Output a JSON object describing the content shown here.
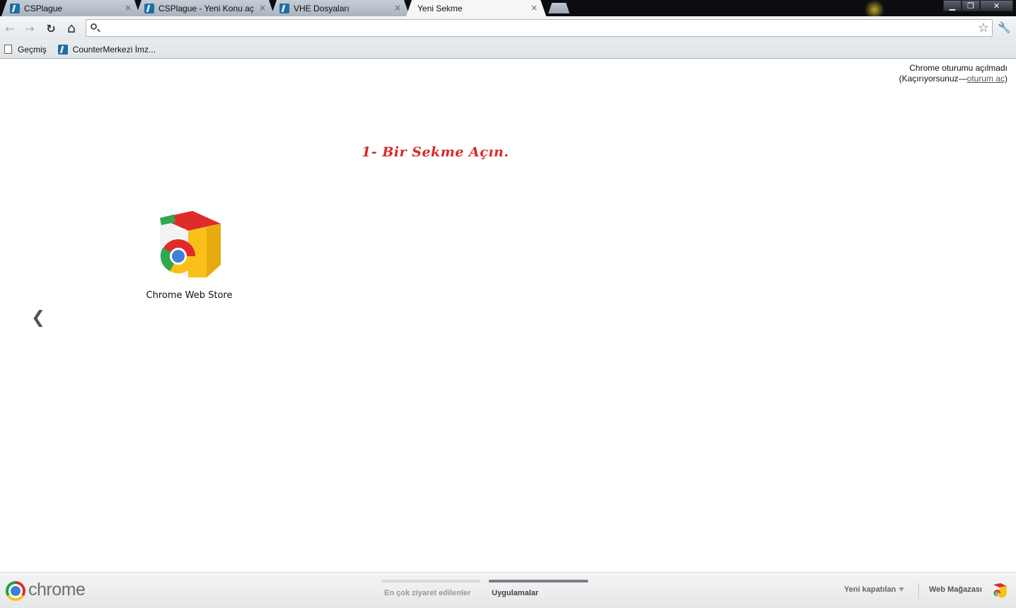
{
  "tabs": [
    {
      "title": "CSPlague",
      "active": false
    },
    {
      "title": "CSPlague - Yeni Konu aç",
      "active": false
    },
    {
      "title": "VHE Dosyaları",
      "active": false
    },
    {
      "title": "Yeni Sekme",
      "active": true
    }
  ],
  "tab_close_glyph": "×",
  "window_controls": {
    "minimize": "▁",
    "maximize": "❐",
    "close": "✕"
  },
  "toolbar": {
    "back_glyph": "←",
    "forward_glyph": "→",
    "reload_glyph": "↻",
    "home_glyph": "⌂",
    "omnibox_value": "",
    "star_glyph": "☆",
    "wrench_glyph": "🔧"
  },
  "bookmarks": [
    {
      "label": "Geçmiş",
      "icon": "page-icon"
    },
    {
      "label": "CounterMerkezi İmz...",
      "icon": "site-favicon"
    }
  ],
  "signin": {
    "line1": "Chrome oturumu açılmadı",
    "prefix": "(Kaçırıyorsunuz—",
    "link": "oturum aç",
    "suffix": ")"
  },
  "annotation": "1- Bir Sekme Açın.",
  "apps": [
    {
      "label": "Chrome Web Store",
      "icon": "chrome-web-store-icon"
    }
  ],
  "pager_left_glyph": "❮",
  "footer": {
    "brand": "chrome",
    "tabs": [
      {
        "label": "En çok ziyaret edilenler",
        "selected": false
      },
      {
        "label": "Uygulamalar",
        "selected": true
      }
    ],
    "recently_closed": "Yeni kapatılan",
    "web_store": "Web Mağazası"
  },
  "colors": {
    "annotation": "#d82a2a",
    "tab_active": "#f4f6f8",
    "tab_inactive": "#b8c0ca",
    "footer_selected_bar": "#7d7f82"
  }
}
